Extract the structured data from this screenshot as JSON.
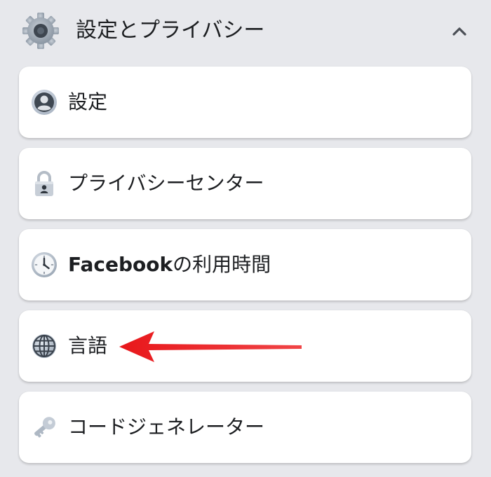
{
  "header": {
    "title": "設定とプライバシー",
    "icon": "gear-icon",
    "toggle_icon": "chevron-up-icon"
  },
  "menu": {
    "items": [
      {
        "label": "設定",
        "icon": "account-icon"
      },
      {
        "label": "プライバシーセンター",
        "icon": "lock-icon"
      },
      {
        "label_latin": "Facebook",
        "label_rest": "の利用時間",
        "icon": "clock-icon"
      },
      {
        "label": "言語",
        "icon": "globe-icon"
      },
      {
        "label": "コードジェネレーター",
        "icon": "key-icon"
      }
    ]
  },
  "annotation": {
    "icon": "red-arrow-icon",
    "color": "#e8171b"
  },
  "colors": {
    "background": "#e7e8ec",
    "card": "#ffffff",
    "text": "#1c1e21"
  }
}
